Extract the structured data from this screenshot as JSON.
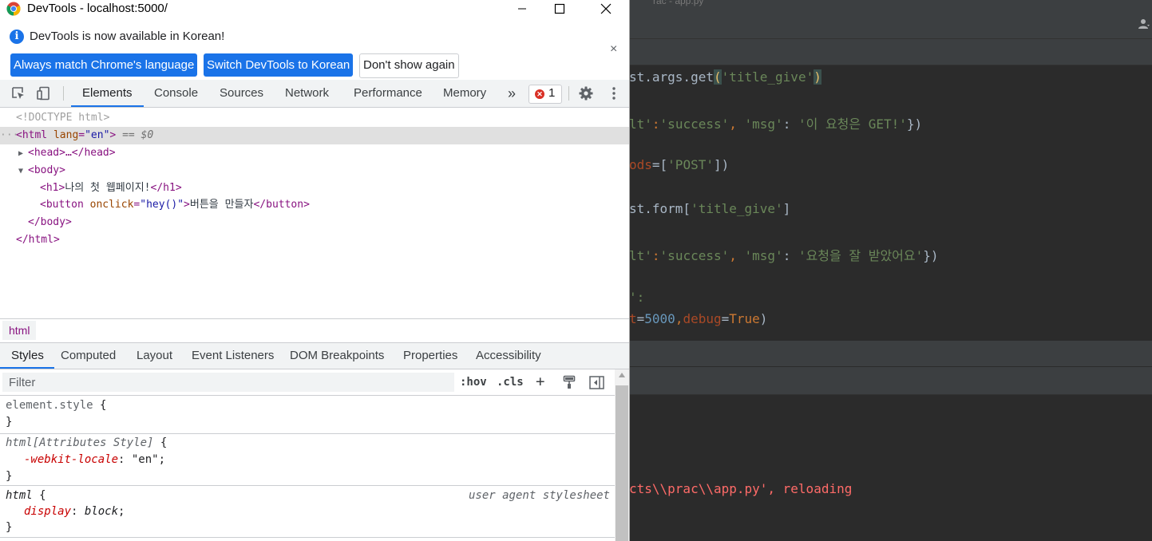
{
  "window": {
    "title": "DevTools - localhost:5000/"
  },
  "infobar": {
    "message": "DevTools is now available in Korean!",
    "btn_match": "Always match Chrome's language",
    "btn_switch": "Switch DevTools to Korean",
    "btn_dont_show": "Don't show again",
    "close": "×"
  },
  "panels": {
    "tabs": [
      "Elements",
      "Console",
      "Sources",
      "Network",
      "Performance",
      "Memory"
    ],
    "more": "»",
    "error_count": "1"
  },
  "dom": {
    "doctype": "<!DOCTYPE html>",
    "html_open": "<html",
    "html_lang_attr": "lang",
    "html_lang_val": "\"en\"",
    "html_close_bracket": ">",
    "selected_marker": " == $0",
    "head_collapsed": "<head>…</head>",
    "body_open": "<body>",
    "h1_open": "<h1>",
    "h1_text": "나의 첫 웹페이지!",
    "h1_close": "</h1>",
    "button_open": "<button",
    "button_attr": "onclick",
    "button_val": "\"hey()\"",
    "button_text": "버튼을 만들자",
    "button_close": "</button>",
    "body_close": "</body>",
    "html_close": "</html>",
    "ellipsis": "···"
  },
  "breadcrumb": {
    "item": "html"
  },
  "sidebar_tabs": [
    "Styles",
    "Computed",
    "Layout",
    "Event Listeners",
    "DOM Breakpoints",
    "Properties",
    "Accessibility"
  ],
  "filter": {
    "placeholder": "Filter",
    "hov": ":hov",
    "cls": ".cls",
    "plus": "+"
  },
  "rules": {
    "r1_selector": "element.style",
    "r2_selector": "html[Attributes Style]",
    "r2_prop": "-webkit-locale",
    "r2_val": "\"en\"",
    "r3_selector": "html",
    "r3_source": "user agent stylesheet",
    "r3_prop": "display",
    "r3_val": "block",
    "open_brace": " {",
    "close_brace": "}",
    "colon": ": ",
    "semi": ";"
  },
  "ide": {
    "top_title": "rac - app.py",
    "line1_a": "st.args.get",
    "line1_b": "(",
    "line1_c": "'title_give'",
    "line1_d": ")",
    "line2_a": "lt'",
    "line2_b": ":",
    "line2_c": "'success'",
    "line2_d": ", ",
    "line2_e": "'msg'",
    "line2_f": ": ",
    "line2_g": "'이 요청은 GET!'",
    "line2_h": "})",
    "line3_a": "ods",
    "line3_b": "=[",
    "line3_c": "'POST'",
    "line3_d": "])",
    "line4_a": "st.form[",
    "line4_b": "'title_give'",
    "line4_c": "]",
    "line5_a": "lt'",
    "line5_b": ":",
    "line5_c": "'success'",
    "line5_d": ", ",
    "line5_e": "'msg'",
    "line5_f": ": ",
    "line5_g": "'요청을 잘 받았어요'",
    "line5_h": "})",
    "line6": "':",
    "line7_a": "t",
    "line7_b": "=",
    "line7_c": "5000",
    "line7_d": ",",
    "line7_e": "debug",
    "line7_f": "=",
    "line7_g": "True",
    "line7_h": ")",
    "console_line": "cts\\\\prac\\\\app.py', reloading"
  }
}
